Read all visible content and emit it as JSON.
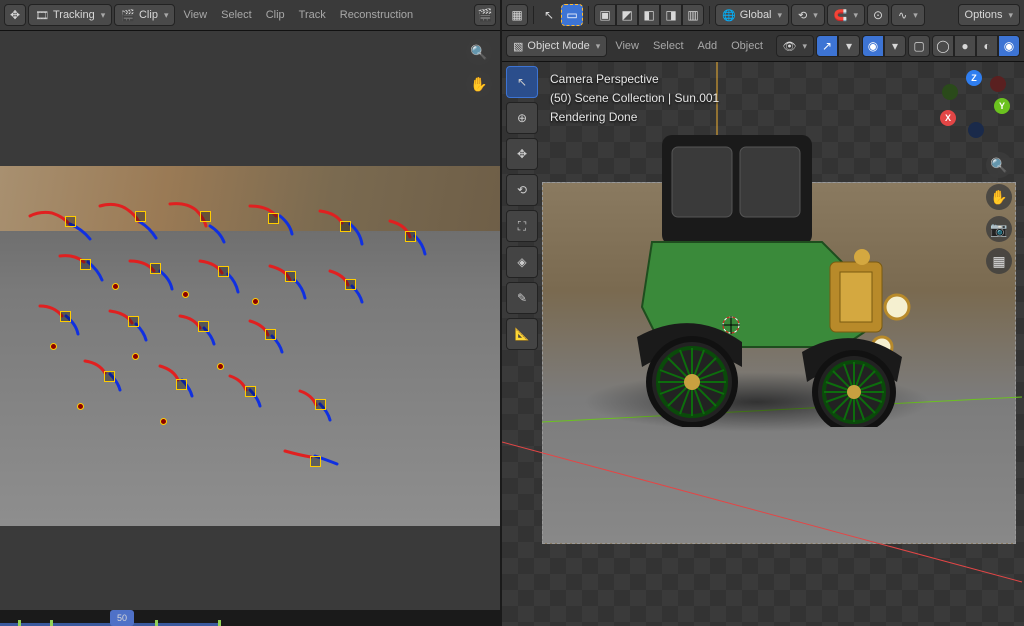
{
  "left": {
    "header": {
      "pivot_label": "",
      "tracking_label": "Tracking",
      "clip_label": "Clip",
      "menus": [
        "View",
        "Select",
        "Clip",
        "Track",
        "Reconstruction"
      ]
    },
    "timeline": {
      "current_frame": "50"
    }
  },
  "right": {
    "header": {
      "orientation_label": "Global",
      "options_label": "Options"
    },
    "header2": {
      "mode_label": "Object Mode",
      "menus": [
        "View",
        "Select",
        "Add",
        "Object"
      ]
    },
    "overlay": {
      "line1": "Camera Perspective",
      "line2": "(50) Scene Collection | Sun.001",
      "line3": "Rendering Done"
    },
    "gizmo": {
      "z": "Z",
      "y": "Y",
      "x": "X"
    }
  }
}
